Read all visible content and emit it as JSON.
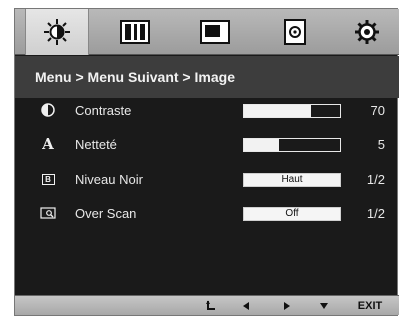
{
  "tabs": [
    {
      "icon": "brightness-sun-icon",
      "active": true
    },
    {
      "icon": "picture-mode-icon",
      "active": false
    },
    {
      "icon": "picture-position-icon",
      "active": false
    },
    {
      "icon": "audio-icon",
      "active": false
    },
    {
      "icon": "settings-gear-icon",
      "active": false
    }
  ],
  "breadcrumb": {
    "part1": "Menu",
    "sep1": " > ",
    "part2": "Menu Suivant",
    "sep2": " > ",
    "part3": "Image"
  },
  "rows": [
    {
      "label": "Contraste",
      "icon": "contrast-icon",
      "kind": "bar",
      "level": 0.7,
      "value": "70"
    },
    {
      "label": "Netteté",
      "icon": "sharpness-a-icon",
      "icon_glyph": "A",
      "kind": "bar",
      "level": 0.36,
      "value": "5"
    },
    {
      "label": "Niveau Noir",
      "icon": "black-level-icon",
      "icon_glyph": "B",
      "kind": "option",
      "option": "Haut",
      "value": "1/2"
    },
    {
      "label": "Over Scan",
      "icon": "overscan-icon",
      "kind": "option",
      "option": "Off",
      "value": "1/2"
    }
  ],
  "footer": {
    "return_icon": "return-icon",
    "left_icon": "left-arrow-icon",
    "right_icon": "right-arrow-icon",
    "down_icon": "down-arrow-icon",
    "exit_label": "EXIT"
  }
}
